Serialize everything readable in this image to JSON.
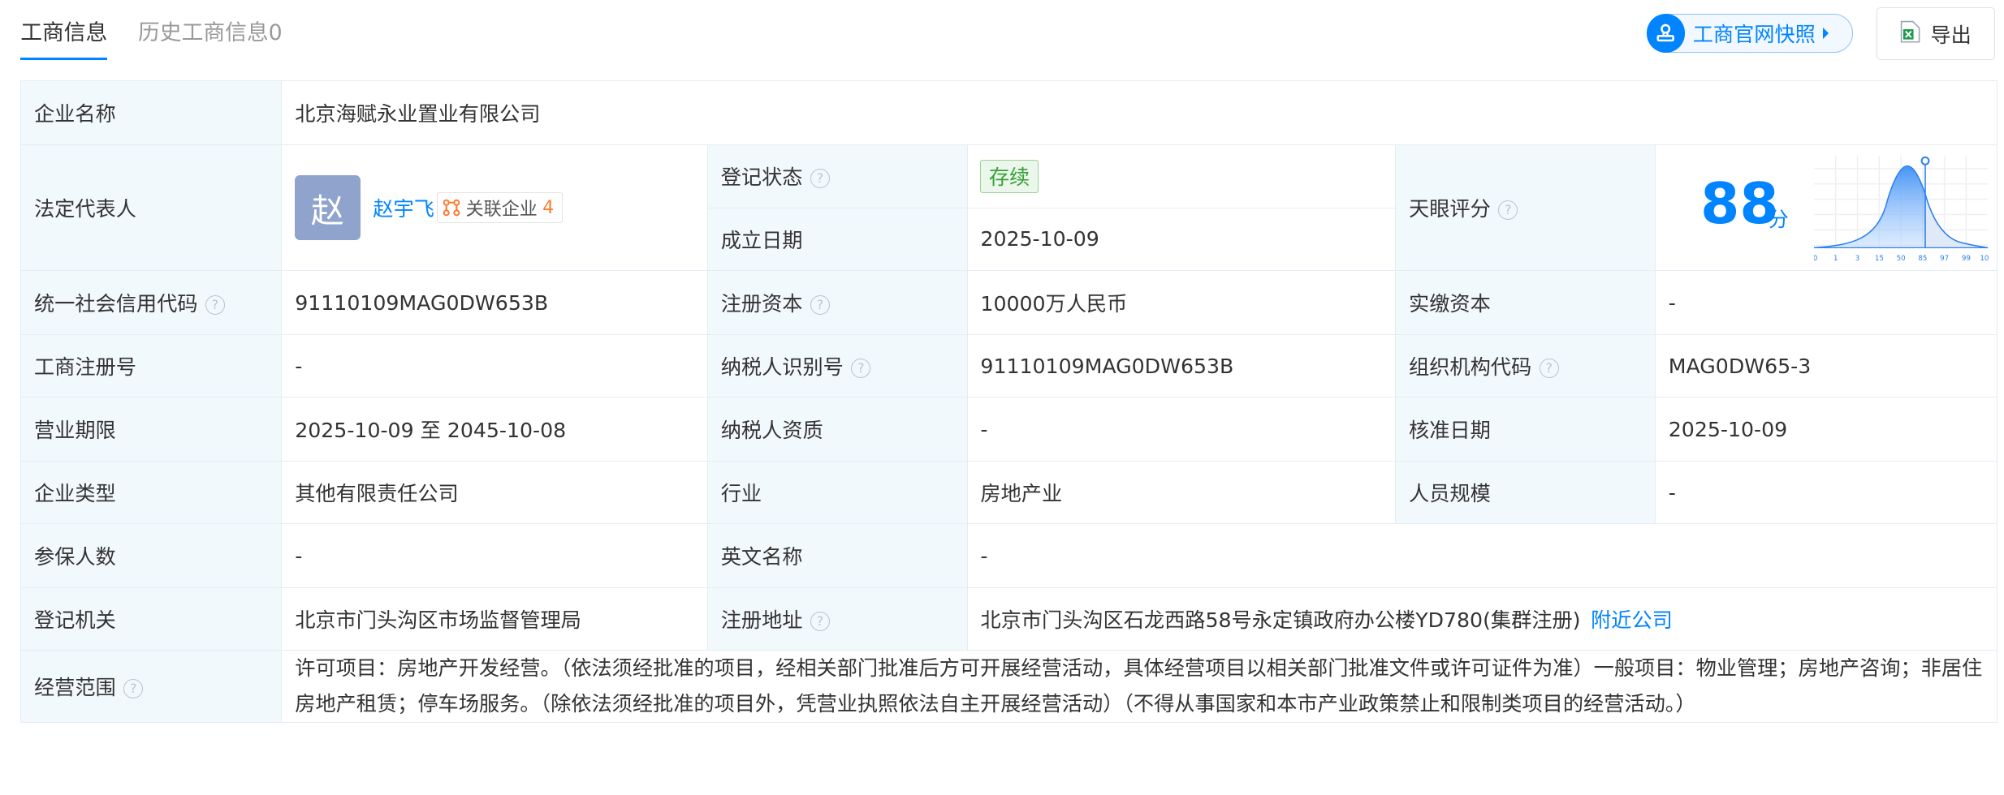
{
  "tabs": [
    {
      "label": "工商信息",
      "active": true
    },
    {
      "label": "历史工商信息0",
      "active": false
    }
  ],
  "actions": {
    "snapshot_label": "工商官网快照",
    "export_label": "导出"
  },
  "company": {
    "name_label": "企业名称",
    "name": "北京海赋永业置业有限公司",
    "legal_rep_label": "法定代表人",
    "legal_rep_avatar": "赵",
    "legal_rep_name": "赵宇飞",
    "related_label": "关联企业",
    "related_count": "4",
    "reg_status_label": "登记状态",
    "reg_status": "存续",
    "found_date_label": "成立日期",
    "found_date": "2025-10-09",
    "score_label": "天眼评分",
    "score": "88",
    "score_unit": "分",
    "uscc_label": "统一社会信用代码",
    "uscc": "91110109MAG0DW653B",
    "reg_capital_label": "注册资本",
    "reg_capital": "10000万人民币",
    "paid_capital_label": "实缴资本",
    "paid_capital": "-",
    "biz_reg_no_label": "工商注册号",
    "biz_reg_no": "-",
    "taxpayer_id_label": "纳税人识别号",
    "taxpayer_id": "91110109MAG0DW653B",
    "org_code_label": "组织机构代码",
    "org_code": "MAG0DW65-3",
    "term_label": "营业期限",
    "term": "2025-10-09 至 2045-10-08",
    "taxpayer_qual_label": "纳税人资质",
    "taxpayer_qual": "-",
    "approval_date_label": "核准日期",
    "approval_date": "2025-10-09",
    "type_label": "企业类型",
    "type": "其他有限责任公司",
    "industry_label": "行业",
    "industry": "房地产业",
    "staff_size_label": "人员规模",
    "staff_size": "-",
    "insured_label": "参保人数",
    "insured": "-",
    "english_name_label": "英文名称",
    "english_name": "-",
    "authority_label": "登记机关",
    "authority": "北京市门头沟区市场监督管理局",
    "address_label": "注册地址",
    "address": "北京市门头沟区石龙西路58号永定镇政府办公楼YD780(集群注册)",
    "nearby_label": "附近公司",
    "scope_label": "经营范围",
    "scope": "许可项目：房地产开发经营。（依法须经批准的项目，经相关部门批准后方可开展经营活动，具体经营项目以相关部门批准文件或许可证件为准）一般项目：物业管理；房地产咨询；非居住房地产租赁；停车场服务。（除依法须经批准的项目外，凭营业执照依法自主开展经营活动）（不得从事国家和本市产业政策禁止和限制类项目的经营活动。）"
  },
  "score_chart": {
    "type": "area",
    "tick_labels": [
      "0",
      "1",
      "3",
      "15",
      "50",
      "85",
      "97",
      "99",
      "100"
    ],
    "marker_value": 88,
    "color": "#0084ff"
  },
  "colors": {
    "accent": "#0084ff",
    "label_bg": "#f2f9fc",
    "border": "#e5ecf3",
    "status_green": "#37a137",
    "count_orange": "#ff7a30"
  }
}
